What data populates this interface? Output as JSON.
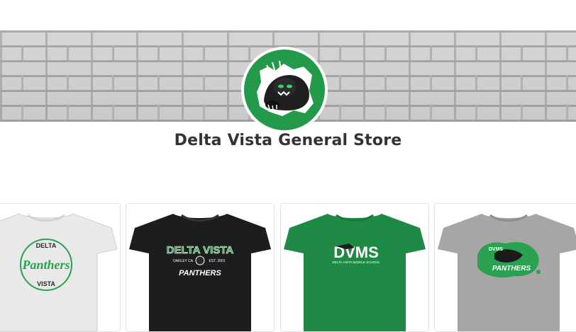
{
  "store": {
    "title": "Delta Vista General Store",
    "logo_icon": "panther-mascot-logo",
    "logo_color": "#239a4a"
  },
  "products": [
    {
      "name": "product-panthers-circle-tee",
      "shirt_color": "#e9e9e9",
      "print_text": [
        "DELTA",
        "Panthers",
        "VISTA"
      ],
      "accent": "#2aa150"
    },
    {
      "name": "product-delta-vista-panthers-tee",
      "shirt_color": "#1d1d1d",
      "print_text": [
        "DELTA VISTA",
        "OAKLEY CA",
        "EST. 2001",
        "PANTHERS"
      ],
      "accent": "#2aa150"
    },
    {
      "name": "product-dvms-tee",
      "shirt_color": "#1f8a46",
      "print_text": [
        "DVMS",
        "DELTA VISTA MIDDLE SCHOOL"
      ],
      "accent": "#ffffff"
    },
    {
      "name": "product-dvms-panthers-splash-tee",
      "shirt_color": "#a6a6a6",
      "print_text": [
        "DVMS",
        "PANTHERS"
      ],
      "accent": "#2aa150"
    }
  ]
}
